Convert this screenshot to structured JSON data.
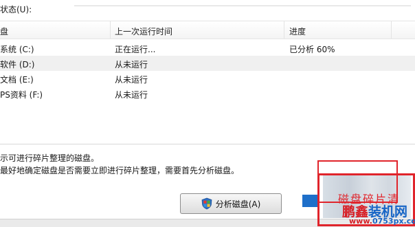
{
  "status": {
    "label": "状态(U):"
  },
  "table": {
    "headers": [
      "盘",
      "上一次运行时间",
      "进度"
    ],
    "rows": [
      {
        "disk": "系统 (C:)",
        "last_run": "正在运行...",
        "progress": "已分析 60%",
        "selected": false
      },
      {
        "disk": "软件 (D:)",
        "last_run": "从未运行",
        "progress": "",
        "selected": true
      },
      {
        "disk": "文档 (E:)",
        "last_run": "从未运行",
        "progress": "",
        "selected": false
      },
      {
        "disk": "PS资料 (F:)",
        "last_run": "从未运行",
        "progress": "",
        "selected": false
      }
    ]
  },
  "info": {
    "line1": "示可进行碎片整理的磁盘。",
    "line2": "最好地确定磁盘是否需要立即进行碎片整理，需要首先分析磁盘。"
  },
  "buttons": {
    "analyze": "分析磁盘(A)"
  },
  "watermark": {
    "handwritten": "磁盘碎片清",
    "logo_main_red": "鹏鑫",
    "logo_main_blue": "装机网",
    "logo_sub_red": "www.",
    "logo_sub_blue": "0753px.com",
    "brand_red": "#d81e25",
    "brand_blue": "#1765c6",
    "highlight_red": "#e0242b"
  },
  "icons": {
    "analyze_icon": "windows-shield-icon"
  }
}
